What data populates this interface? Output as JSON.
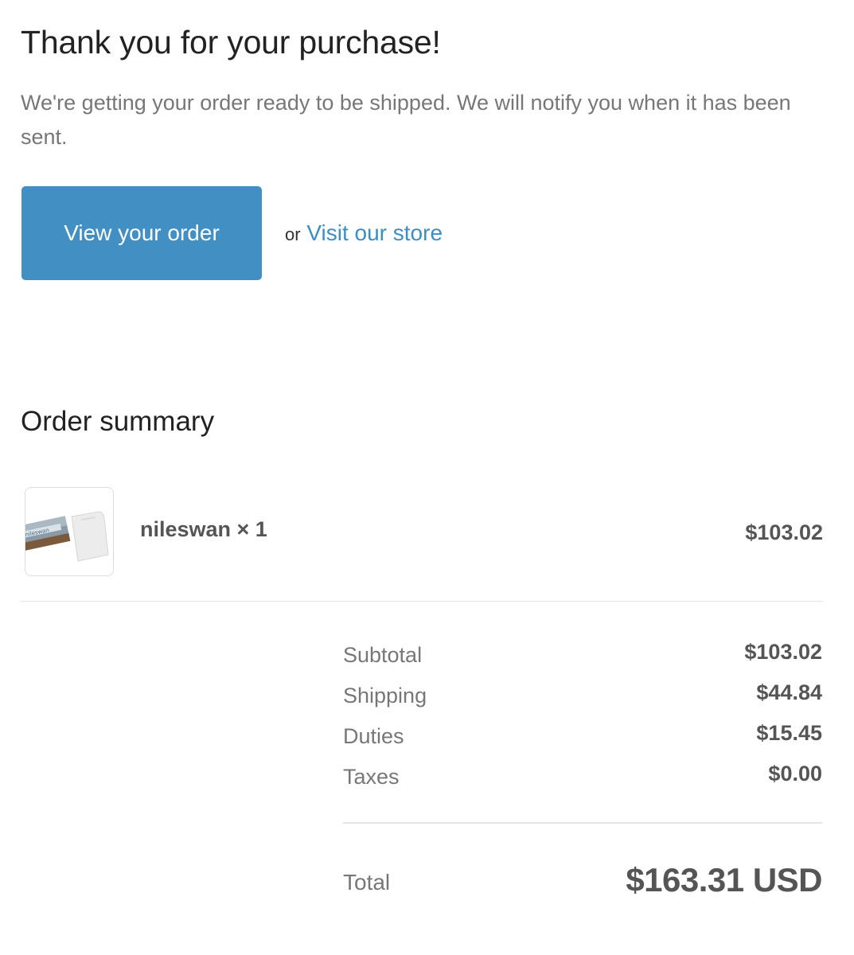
{
  "header": {
    "title": "Thank you for your purchase!",
    "message": "We're getting your order ready to be shipped. We will notify you when it has been sent."
  },
  "actions": {
    "view_order_label": "View your order",
    "or_text": "or",
    "visit_store_label": "Visit our store",
    "accent_color": "#428fc4",
    "link_color": "#3a8fc6"
  },
  "summary": {
    "title": "Order summary",
    "items": [
      {
        "name": "nileswan × 1",
        "price": "$103.02",
        "thumbnail_text": "nileswan"
      }
    ],
    "lines": [
      {
        "label": "Subtotal",
        "value": "$103.02"
      },
      {
        "label": "Shipping",
        "value": "$44.84"
      },
      {
        "label": "Duties",
        "value": "$15.45"
      },
      {
        "label": "Taxes",
        "value": "$0.00"
      }
    ],
    "total": {
      "label": "Total",
      "value": "$163.31 USD"
    }
  }
}
